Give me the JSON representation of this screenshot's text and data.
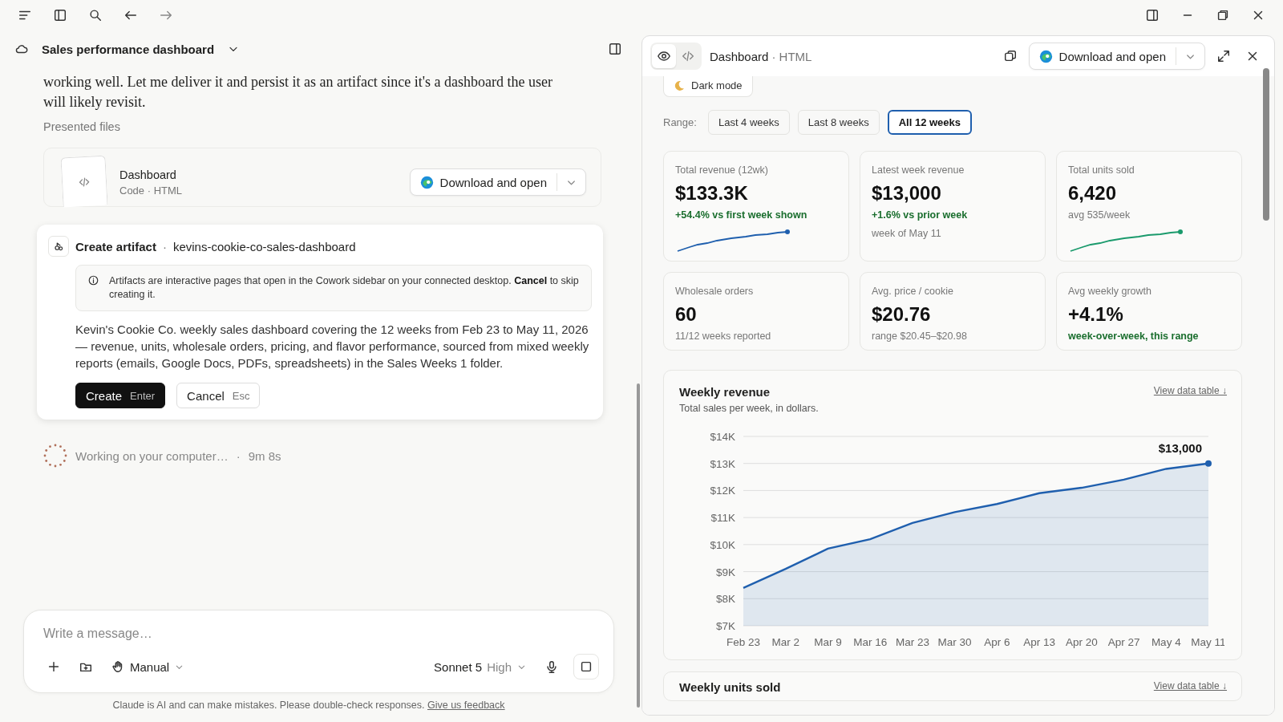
{
  "conversation": {
    "title": "Sales performance dashboard",
    "message": "working well. Let me deliver it and persist it as an artifact since it's a dashboard the user will likely revisit.",
    "files_heading": "Presented files",
    "file": {
      "name": "Dashboard",
      "meta": "Code · HTML",
      "action": "Download and open"
    },
    "artifact_prompt": {
      "title": "Create artifact",
      "separator": "·",
      "slug": "kevins-cookie-co-sales-dashboard",
      "notice": "Artifacts are interactive pages that open in the Cowork sidebar on your connected desktop. **Cancel** to skip creating it.",
      "description": "Kevin's Cookie Co. weekly sales dashboard covering the 12 weeks from Feb 23 to May 11, 2026 — revenue, units, wholesale orders, pricing, and flavor performance, sourced from mixed weekly reports (emails, Google Docs, PDFs, spreadsheets) in the Sales Weeks 1 folder.",
      "buttons": [
        {
          "kind": "primary",
          "label": "Create",
          "shortcut": "Enter"
        },
        {
          "kind": "secondary",
          "label": "Cancel",
          "shortcut": "Esc"
        }
      ]
    },
    "status": {
      "text": "Working on your computer…",
      "separator": "·",
      "elapsed": "9m 8s"
    }
  },
  "composer": {
    "placeholder": "Write a message…",
    "mode": "Manual",
    "model": "Sonnet 5",
    "effort": "High"
  },
  "disclaimer": {
    "text": "Claude is AI and can make mistakes. Please double-check responses.",
    "link": "Give us feedback"
  },
  "preview": {
    "view_toggle": [
      {
        "kind": "preview",
        "selected": true
      },
      {
        "kind": "code",
        "selected": false
      }
    ],
    "title": "Dashboard",
    "subtitle": "· HTML",
    "action": "Download and open",
    "dashboard": {
      "dark_mode": "Dark mode",
      "range_label": "Range:",
      "ranges": [
        {
          "label": "Last 4 weeks",
          "selected": false
        },
        {
          "label": "Last 8 weeks",
          "selected": false
        },
        {
          "label": "All 12 weeks",
          "selected": true
        }
      ],
      "stats": [
        {
          "label": "Total revenue (12wk)",
          "value": "$133.3K",
          "note": "+54.4% vs first week shown",
          "kind": "positive",
          "sparkline": {
            "color": "#1f5fae"
          }
        },
        {
          "label": "Latest week revenue",
          "value": "$13,000",
          "note": "+1.6% vs prior week",
          "kind": "positive",
          "detail": "week of May 11"
        },
        {
          "label": "Total units sold",
          "value": "6,420",
          "note": "avg 535/week",
          "kind": "muted",
          "sparkline": {
            "color": "#1a9a6c"
          }
        },
        {
          "label": "Wholesale orders",
          "value": "60",
          "note": "11/12 weeks reported",
          "kind": "muted"
        },
        {
          "label": "Avg. price / cookie",
          "value": "$20.76",
          "note": "range $20.45–$20.98",
          "kind": "muted"
        },
        {
          "label": "Avg weekly growth",
          "value": "+4.1%",
          "note": "week-over-week, this range",
          "kind": "positive"
        }
      ],
      "charts": [
        {
          "title": "Weekly revenue",
          "subtitle": "Total sales per week, in dollars.",
          "link": "View data table ↓",
          "chart_data": {
            "type": "area",
            "categories": [
              "Feb 23",
              "Mar 2",
              "Mar 9",
              "Mar 16",
              "Mar 23",
              "Mar 30",
              "Apr 6",
              "Apr 13",
              "Apr 20",
              "Apr 27",
              "May 4",
              "May 11"
            ],
            "grid": true,
            "series": [
              {
                "color": "#1f5fae",
                "values": [
                  8400,
                  9100,
                  9850,
                  10200,
                  10800,
                  11200,
                  11500,
                  11900,
                  12100,
                  12400,
                  12800,
                  13000
                ]
              }
            ],
            "ylim": [
              7000,
              14000
            ],
            "yticks": [
              {
                "value": 7000,
                "label": "$7K"
              },
              {
                "value": 8000,
                "label": "$8K"
              },
              {
                "value": 9000,
                "label": "$9K"
              },
              {
                "value": 10000,
                "label": "$10K"
              },
              {
                "value": 11000,
                "label": "$11K"
              },
              {
                "value": 12000,
                "label": "$12K"
              },
              {
                "value": 13000,
                "label": "$13K"
              },
              {
                "value": 14000,
                "label": "$14K"
              }
            ],
            "annotations": [
              {
                "x": "May 11",
                "y": 13000,
                "text": "$13,000"
              }
            ]
          }
        },
        {
          "title": "Weekly units sold",
          "link": "View data table ↓"
        }
      ]
    }
  }
}
